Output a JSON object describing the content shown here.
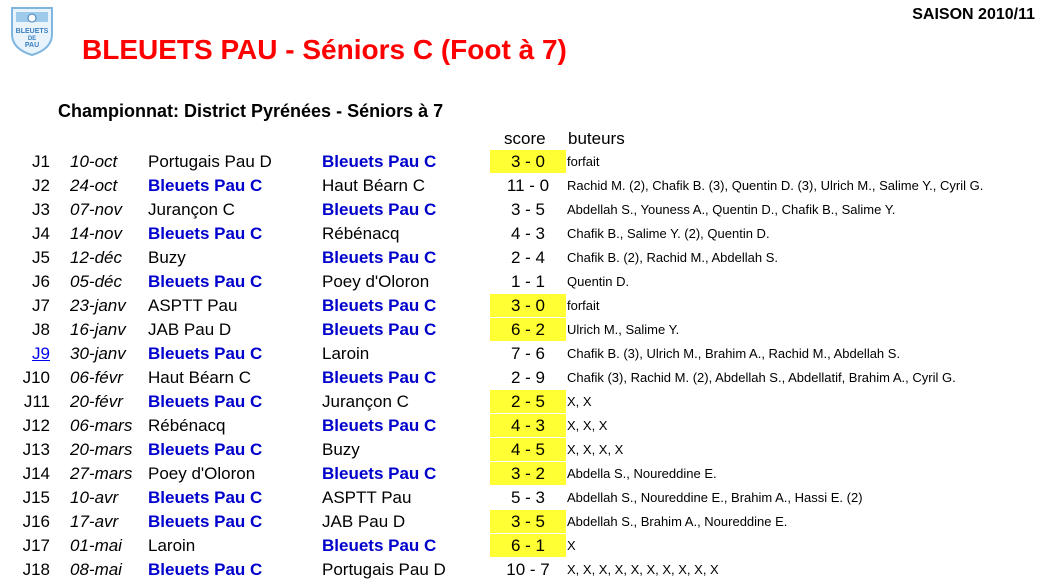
{
  "header": {
    "season": "SAISON 2010/11",
    "title": "BLEUETS PAU - Séniors C (Foot à 7)",
    "logo_text": "BLEUETS DE PAU"
  },
  "section": {
    "title": "Championnat: District Pyrénées - Séniors à 7",
    "score_header": "score",
    "scorers_header": "buteurs"
  },
  "colors": {
    "title": "#ff0000",
    "own_team": "#0000cc",
    "highlight": "#ffff33"
  },
  "matches": [
    {
      "round": "J1",
      "date": "10-oct",
      "home": "Portugais Pau D",
      "away": "Bleuets Pau C",
      "own": "away",
      "score": "3 - 0",
      "highlight": true,
      "scorers": "forfait"
    },
    {
      "round": "J2",
      "date": "24-oct",
      "home": "Bleuets Pau C",
      "away": "Haut Béarn C",
      "own": "home",
      "score": "11 - 0",
      "highlight": false,
      "scorers": "Rachid M. (2), Chafik B. (3), Quentin D. (3), Ulrich M., Salime Y., Cyril G."
    },
    {
      "round": "J3",
      "date": "07-nov",
      "home": "Jurançon C",
      "away": "Bleuets Pau C",
      "own": "away",
      "score": "3 - 5",
      "highlight": false,
      "scorers": "Abdellah S., Youness A., Quentin D., Chafik B., Salime Y."
    },
    {
      "round": "J4",
      "date": "14-nov",
      "home": "Bleuets Pau C",
      "away": "Rébénacq",
      "own": "home",
      "score": "4 - 3",
      "highlight": false,
      "scorers": "Chafik B., Salime Y. (2), Quentin D."
    },
    {
      "round": "J5",
      "date": "12-déc",
      "home": "Buzy",
      "away": "Bleuets Pau C",
      "own": "away",
      "score": "2 - 4",
      "highlight": false,
      "scorers": "Chafik B. (2), Rachid M., Abdellah S."
    },
    {
      "round": "J6",
      "date": "05-déc",
      "home": "Bleuets Pau C",
      "away": "Poey d'Oloron",
      "own": "home",
      "score": "1 - 1",
      "highlight": false,
      "scorers": "Quentin D."
    },
    {
      "round": "J7",
      "date": "23-janv",
      "home": "ASPTT Pau",
      "away": "Bleuets Pau C",
      "own": "away",
      "score": "3 - 0",
      "highlight": true,
      "scorers": "forfait"
    },
    {
      "round": "J8",
      "date": "16-janv",
      "home": "JAB Pau D",
      "away": "Bleuets Pau C",
      "own": "away",
      "score": "6 - 2",
      "highlight": true,
      "scorers": "Ulrich M., Salime Y."
    },
    {
      "round": "J9",
      "date": "30-janv",
      "home": "Bleuets Pau C",
      "away": "Laroin",
      "own": "home",
      "score": "7 - 6",
      "highlight": false,
      "link": true,
      "scorers": "Chafik B. (3), Ulrich M., Brahim A., Rachid M., Abdellah S."
    },
    {
      "round": "J10",
      "date": "06-févr",
      "home": "Haut Béarn C",
      "away": "Bleuets Pau C",
      "own": "away",
      "score": "2 - 9",
      "highlight": false,
      "scorers": "Chafik (3), Rachid M. (2), Abdellah S., Abdellatif, Brahim A., Cyril G."
    },
    {
      "round": "J11",
      "date": "20-févr",
      "home": "Bleuets Pau C",
      "away": "Jurançon C",
      "own": "home",
      "score": "2 - 5",
      "highlight": true,
      "scorers": "X, X"
    },
    {
      "round": "J12",
      "date": "06-mars",
      "home": "Rébénacq",
      "away": "Bleuets Pau C",
      "own": "away",
      "score": "4 - 3",
      "highlight": true,
      "scorers": "X, X, X"
    },
    {
      "round": "J13",
      "date": "20-mars",
      "home": "Bleuets Pau C",
      "away": "Buzy",
      "own": "home",
      "score": "4 - 5",
      "highlight": true,
      "scorers": "X, X, X, X"
    },
    {
      "round": "J14",
      "date": "27-mars",
      "home": "Poey d'Oloron",
      "away": "Bleuets Pau C",
      "own": "away",
      "score": "3 - 2",
      "highlight": true,
      "scorers": "Abdella S., Noureddine E."
    },
    {
      "round": "J15",
      "date": "10-avr",
      "home": "Bleuets Pau C",
      "away": "ASPTT Pau",
      "own": "home",
      "score": "5 - 3",
      "highlight": false,
      "scorers": "Abdellah S., Noureddine E., Brahim A., Hassi E. (2)"
    },
    {
      "round": "J16",
      "date": "17-avr",
      "home": "Bleuets Pau C",
      "away": "JAB Pau D",
      "own": "home",
      "score": "3 - 5",
      "highlight": true,
      "scorers": "Abdellah S., Brahim A., Noureddine E."
    },
    {
      "round": "J17",
      "date": "01-mai",
      "home": "Laroin",
      "away": "Bleuets Pau C",
      "own": "away",
      "score": "6 - 1",
      "highlight": true,
      "scorers": "X"
    },
    {
      "round": "J18",
      "date": "08-mai",
      "home": "Bleuets Pau C",
      "away": "Portugais Pau D",
      "own": "home",
      "score": "10 - 7",
      "highlight": false,
      "scorers": "X, X, X, X, X, X, X, X, X, X"
    }
  ]
}
